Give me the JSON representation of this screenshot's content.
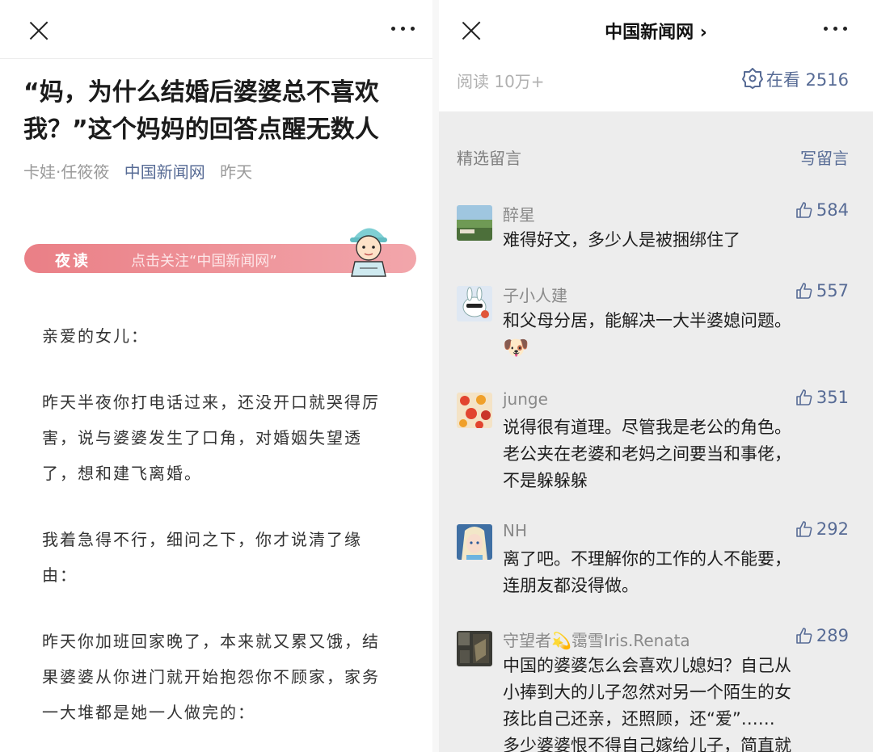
{
  "left": {
    "article_title": "“妈，为什么结婚后婆婆总不喜欢我？”这个妈妈的回答点醒无数人",
    "meta": {
      "author": "卡娃·任筱筱",
      "account": "中国新闻网",
      "date": "昨天"
    },
    "banner": {
      "tag": "夜读",
      "follow_text": "点击关注“中国新闻网”"
    },
    "paragraphs": [
      {
        "lines": [
          "亲爱的女儿："
        ]
      },
      {
        "lines": [
          "昨天半夜你打电话过来，还没开口就哭得厉",
          "害，说与婆婆发生了口角，对婚姻失望透",
          "了，想和建飞离婚。"
        ]
      },
      {
        "lines": [
          "我着急得不行，细问之下，你才说清了缘",
          "由："
        ]
      },
      {
        "lines": [
          "昨天你加班回家晚了，本来就又累又饿，结",
          "果婆婆从你进门就开始抱怨你不顾家，家务",
          "一大堆都是她一人做完的："
        ]
      }
    ]
  },
  "right": {
    "title": "中国新闻网 ›",
    "read_count": "阅读 10万+",
    "watching": "在看 2516",
    "comments_header": "精选留言",
    "write_comment": "写留言",
    "comments": [
      {
        "name": "醉星",
        "likes": "584",
        "lines": [
          "难得好文，多少人是被捆绑住了"
        ]
      },
      {
        "name": "子小人建",
        "likes": "557",
        "lines": [
          "和父母分居，能解决一大半婆媳问题。"
        ],
        "emoji": "🐶"
      },
      {
        "name": "junge",
        "likes": "351",
        "lines": [
          "说得很有道理。尽管我是老公的角色。",
          "老公夹在老婆和老妈之间要当和事佬，",
          "不是躲躲躲"
        ]
      },
      {
        "name": "NH",
        "likes": "292",
        "lines": [
          "离了吧。不理解你的工作的人不能要，",
          "连朋友都没得做。"
        ]
      },
      {
        "name": "守望者💫霭雪Iris.Renata",
        "likes": "289",
        "lines": [
          "中国的婆婆怎么会喜欢儿媳妇？自己从",
          "小捧到大的儿子忽然对另一个陌生的女",
          "孩比自己还亲，还照顾，还“爱”……",
          "多少婆婆恨不得自己嫁给儿子，简直就"
        ]
      }
    ]
  },
  "colors": {
    "link": "#576b95",
    "comment_bg": "#ededed",
    "banner": "#ea7f86"
  }
}
